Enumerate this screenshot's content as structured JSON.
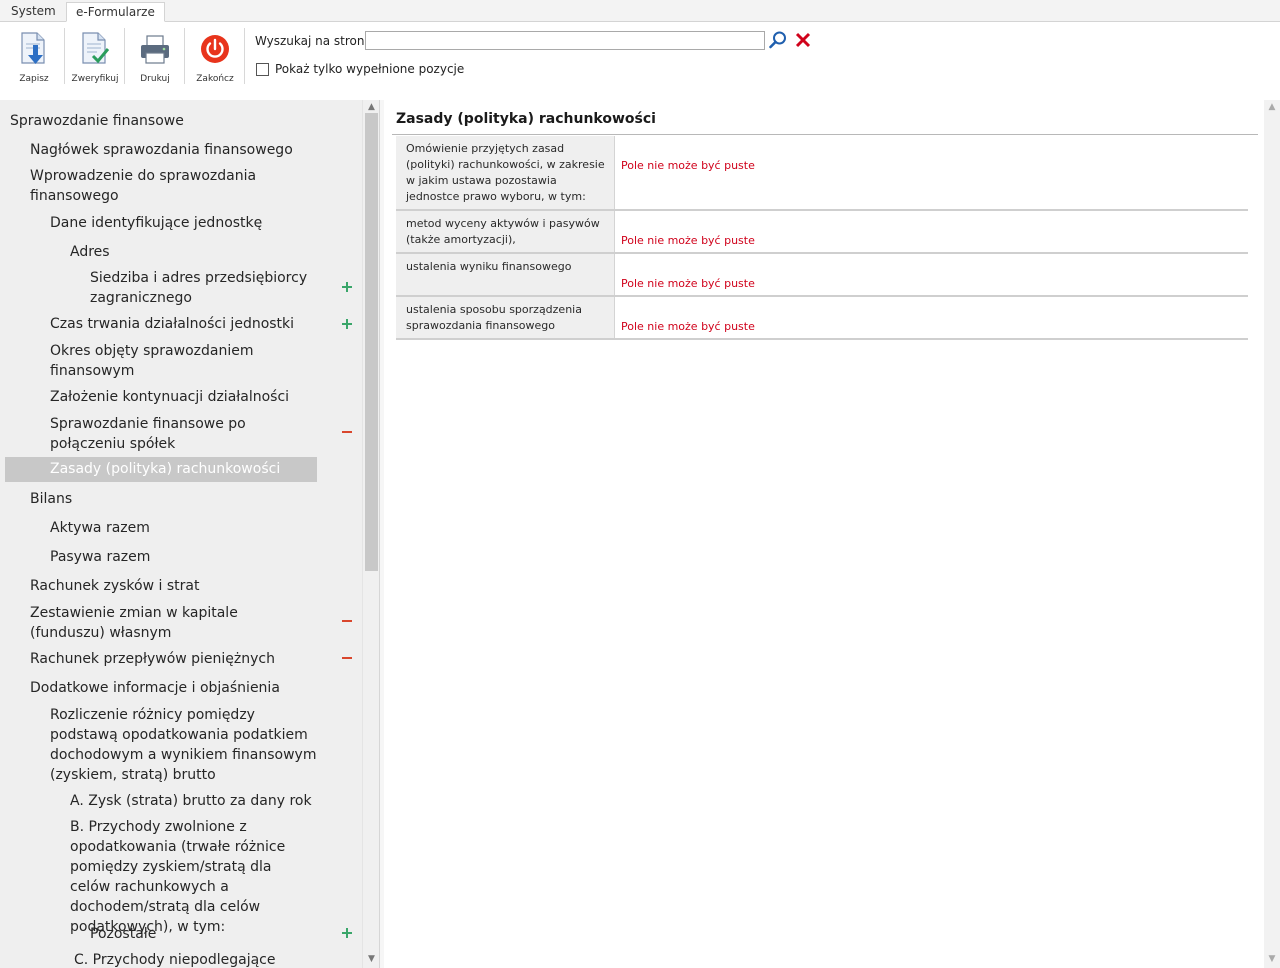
{
  "tabs": [
    {
      "label": "System"
    },
    {
      "label": "e-Formularze"
    }
  ],
  "toolbar": {
    "save_label": "Zapisz",
    "verify_label": "Zweryfikuj",
    "print_label": "Drukuj",
    "exit_label": "Zakończ",
    "search_label": "Wyszukaj na stronie",
    "search_value": "",
    "only_filled_label": "Pokaż tylko wypełnione pozycje",
    "only_filled_checked": false
  },
  "tree": {
    "items": [
      {
        "label": "Sprawozdanie finansowe",
        "level": 0,
        "mark": "none",
        "selected": false
      },
      {
        "label": "Nagłówek sprawozdania finansowego",
        "level": 1,
        "mark": "none",
        "selected": false
      },
      {
        "label": "Wprowadzenie do sprawozdania finansowego",
        "level": 1,
        "mark": "none",
        "selected": false
      },
      {
        "label": "Dane identyfikujące jednostkę",
        "level": 2,
        "mark": "none",
        "selected": false
      },
      {
        "label": "Adres",
        "level": 3,
        "mark": "none",
        "selected": false
      },
      {
        "label": "Siedziba i adres przedsiębiorcy zagranicznego",
        "level": 4,
        "mark": "plus",
        "selected": false
      },
      {
        "label": "Czas trwania działalności jednostki",
        "level": 2,
        "mark": "plus",
        "selected": false
      },
      {
        "label": "Okres objęty sprawozdaniem finansowym",
        "level": 2,
        "mark": "none",
        "selected": false
      },
      {
        "label": "Założenie kontynuacji działalności",
        "level": 2,
        "mark": "none",
        "selected": false
      },
      {
        "label": "Sprawozdanie finansowe po połączeniu spółek",
        "level": 2,
        "mark": "minus",
        "selected": false
      },
      {
        "label": "Zasady (polityka) rachunkowości",
        "level": 2,
        "mark": "none",
        "selected": true
      },
      {
        "label": "Bilans",
        "level": 1,
        "mark": "none",
        "selected": false
      },
      {
        "label": "Aktywa razem",
        "level": 2,
        "mark": "none",
        "selected": false
      },
      {
        "label": "Pasywa razem",
        "level": 2,
        "mark": "none",
        "selected": false
      },
      {
        "label": "Rachunek zysków i strat",
        "level": 1,
        "mark": "none",
        "selected": false
      },
      {
        "label": "Zestawienie zmian w kapitale (funduszu) własnym",
        "level": 1,
        "mark": "minus",
        "selected": false
      },
      {
        "label": "Rachunek przepływów pieniężnych",
        "level": 1,
        "mark": "minus",
        "selected": false
      },
      {
        "label": "Dodatkowe informacje i objaśnienia",
        "level": 1,
        "mark": "none",
        "selected": false
      },
      {
        "label": "Rozliczenie różnicy pomiędzy podstawą opodatkowania podatkiem dochodowym a wynikiem finansowym (zyskiem, stratą) brutto",
        "level": 2,
        "mark": "none",
        "selected": false
      },
      {
        "label": "A. Zysk (strata) brutto za dany rok",
        "level": 3,
        "mark": "none",
        "selected": false
      },
      {
        "label": "B. Przychody zwolnione z opodatkowania (trwałe różnice pomiędzy zyskiem/stratą dla celów rachunkowych a dochodem/stratą dla celów podatkowych), w tym:",
        "level": 3,
        "mark": "none",
        "selected": false
      },
      {
        "label": "Pozostałe",
        "level": 4,
        "mark": "plus",
        "selected": false
      },
      {
        "label": "C. Przychody niepodlegające",
        "level": 3,
        "mark": "none",
        "selected": false
      }
    ]
  },
  "content": {
    "title": "Zasady (polityka) rachunkowości",
    "rows": [
      {
        "label": "Omówienie przyjętych zasad (polityki) rachunkowości, w zakresie w jakim ustawa pozostawia jednostce prawo wyboru, w tym:",
        "error": "Pole nie może być puste"
      },
      {
        "label": "metod wyceny aktywów i pasywów (także amortyzacji),",
        "error": "Pole nie może być puste"
      },
      {
        "label": "ustalenia wyniku finansowego",
        "error": "Pole nie może być puste"
      },
      {
        "label": "ustalenia sposobu sporządzenia sprawozdania finansowego",
        "error": "Pole nie może być puste"
      }
    ]
  },
  "colors": {
    "error": "#d0021b",
    "plus": "#3aa66a",
    "minus": "#d9462d",
    "exit_icon": "#e8341c",
    "selection": "#c8c8c8"
  },
  "icons": {
    "save": "save-document-icon",
    "verify": "verify-document-icon",
    "print": "printer-icon",
    "exit": "power-icon",
    "search": "magnifier-icon",
    "clear": "close-x-icon"
  }
}
